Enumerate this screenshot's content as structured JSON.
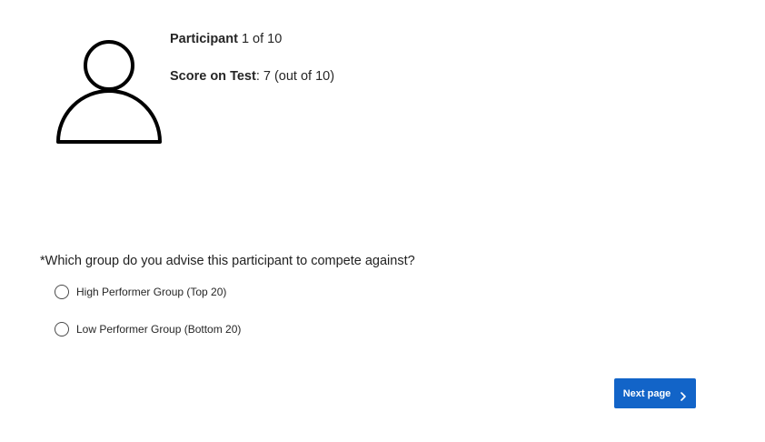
{
  "participant": {
    "label": "Participant",
    "value": "1 of 10",
    "icon": "person-icon"
  },
  "score": {
    "label": "Score on Test",
    "value": ": 7 (out of 10)"
  },
  "question": {
    "text": "*Which group do you advise this participant to compete against?",
    "options": [
      {
        "label": "High Performer Group (Top 20)",
        "selected": false
      },
      {
        "label": "Low Performer Group (Bottom 20)",
        "selected": false
      }
    ]
  },
  "navigation": {
    "next_label": "Next page",
    "next_icon": "chevron-right-icon"
  },
  "colors": {
    "accent": "#1264c8",
    "text": "#262626"
  }
}
